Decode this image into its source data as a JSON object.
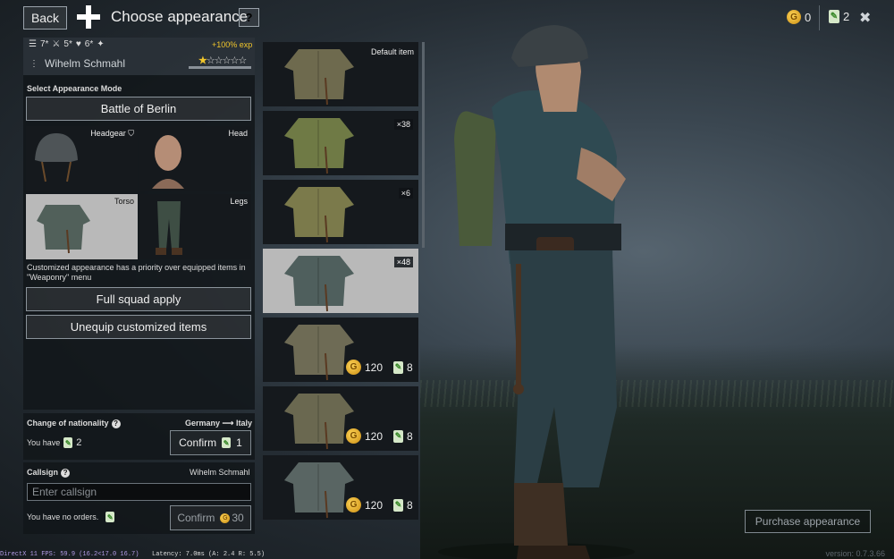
{
  "header": {
    "back_label": "Back",
    "title": "Choose appearance",
    "help_label": "?",
    "gold_count": "0",
    "orders_count": "2",
    "close_label": "✖"
  },
  "squad": {
    "ranks": [
      "7*",
      "5*",
      "6*"
    ],
    "exp_bonus": "+100% exp",
    "soldier_name": "Wihelm Schmahl",
    "stars": 1,
    "stars_max": 6
  },
  "appearance": {
    "mode_label": "Select Appearance Mode",
    "mode_value": "Battle of Berlin",
    "slots": {
      "headgear": "Headgear",
      "head": "Head",
      "torso": "Torso",
      "legs": "Legs"
    },
    "selected_slot": "Torso",
    "note": "Customized appearance has a priority over equipped items in \"Weaponry\" menu",
    "full_squad_apply": "Full squad apply",
    "unequip": "Unequip customized items"
  },
  "nationality": {
    "label": "Change of nationality",
    "from": "Germany",
    "arrow": "⟶",
    "to": "Italy",
    "you_have_label": "You have",
    "you_have_count": "2",
    "confirm_label": "Confirm",
    "confirm_cost": "1"
  },
  "callsign": {
    "label": "Callsign",
    "current": "Wihelm Schmahl",
    "placeholder": "Enter callsign",
    "no_orders": "You have no orders.",
    "confirm_label": "Confirm",
    "confirm_cost": "30"
  },
  "items": [
    {
      "label": "Default item",
      "color": "#6e6a4e"
    },
    {
      "count": "×38",
      "color": "#6f7a45"
    },
    {
      "count": "×6",
      "color": "#7b7a4b"
    },
    {
      "count": "×48",
      "color": "#4f5f5d",
      "selected": true
    },
    {
      "price_gold": "120",
      "price_orders": "8",
      "color": "#6e6b55"
    },
    {
      "price_gold": "120",
      "price_orders": "8",
      "color": "#6a6850"
    },
    {
      "price_gold": "120",
      "price_orders": "8",
      "color": "#596563"
    }
  ],
  "purchase_label": "Purchase appearance",
  "debug": {
    "fps": "DirectX 11 FPS: 59.9 (16.2<17.0 16.7)",
    "latency": "Latency: 7.0ms (A: 2.4 R: 5.5)",
    "version": "version: 0.7.3.66"
  }
}
